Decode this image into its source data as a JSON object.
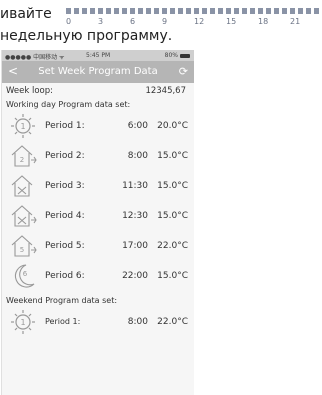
{
  "caption": {
    "line1": "ивайте",
    "line2": "недельную программу."
  },
  "timeline_ticks": [
    "0",
    "3",
    "6",
    "9",
    "12",
    "15",
    "18",
    "21"
  ],
  "statusbar": {
    "carrier": "●●●●● 中国移动 ᯤ",
    "time": "5:45 PM",
    "battery": "80%"
  },
  "navbar": {
    "back": "<",
    "title": "Set Week Program Data",
    "refresh": "⟳"
  },
  "week_loop": {
    "label": "Week loop:",
    "value": "12345,67"
  },
  "working_section": "Working day Program data set:",
  "working_periods": [
    {
      "label": "Period 1:",
      "time": "6:00",
      "temp": "20.0°C",
      "icon": "sun-1-icon",
      "num": "1"
    },
    {
      "label": "Period 2:",
      "time": "8:00",
      "temp": "15.0°C",
      "icon": "house-leave-icon",
      "num": "2"
    },
    {
      "label": "Period 3:",
      "time": "11:30",
      "temp": "15.0°C",
      "icon": "house-return-icon",
      "num": "3"
    },
    {
      "label": "Period 4:",
      "time": "12:30",
      "temp": "15.0°C",
      "icon": "house-leave-icon",
      "num": "4"
    },
    {
      "label": "Period 5:",
      "time": "17:00",
      "temp": "22.0°C",
      "icon": "house-return-icon",
      "num": "5"
    },
    {
      "label": "Period 6:",
      "time": "22:00",
      "temp": "15.0°C",
      "icon": "moon-icon",
      "num": "6"
    }
  ],
  "weekend_section": "Weekend Program data set:",
  "weekend_periods": [
    {
      "label": "Period 1:",
      "time": "8:00",
      "temp": "22.0°C",
      "icon": "sun-1-icon",
      "num": "1"
    }
  ]
}
